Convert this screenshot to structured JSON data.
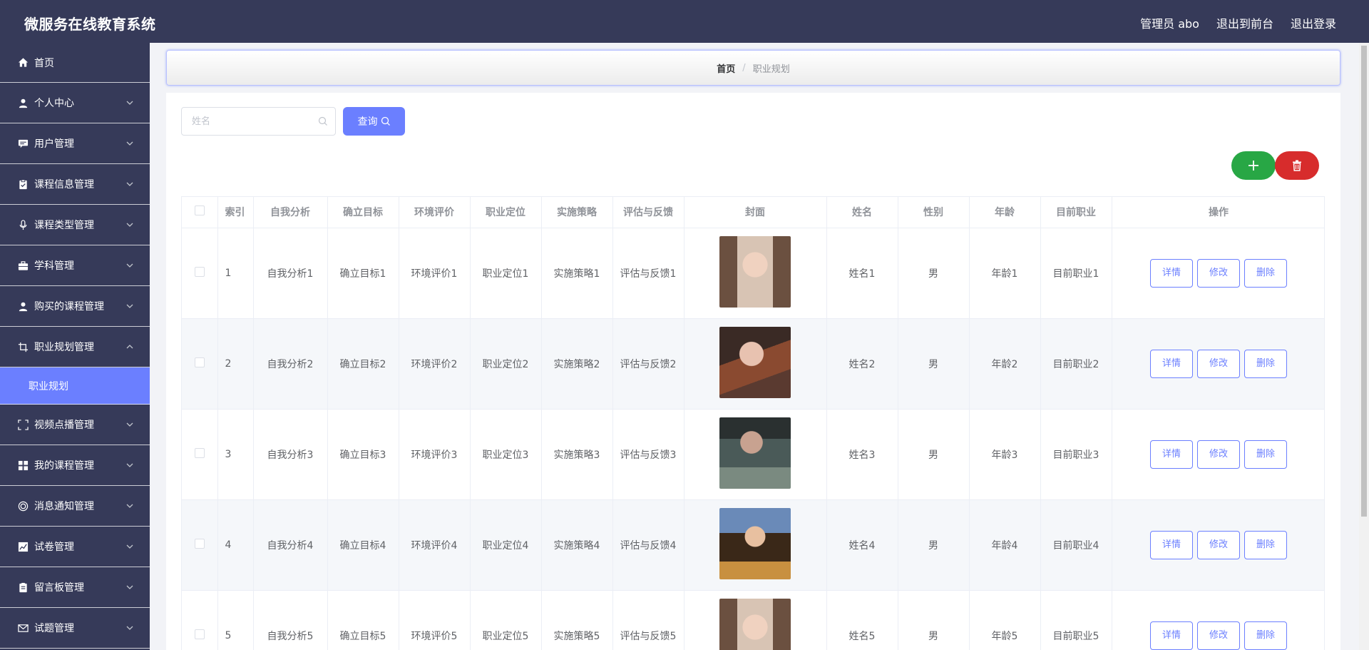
{
  "app": {
    "title": "微服务在线教育系统",
    "admin_label": "管理员 abo",
    "to_frontend": "退出到前台",
    "logout": "退出登录"
  },
  "sidebar": {
    "home": "首页",
    "items": [
      {
        "label": "个人中心",
        "icon": "user-icon"
      },
      {
        "label": "用户管理",
        "icon": "chat-icon"
      },
      {
        "label": "课程信息管理",
        "icon": "clipboard-icon"
      },
      {
        "label": "课程类型管理",
        "icon": "microphone-icon"
      },
      {
        "label": "学科管理",
        "icon": "briefcase-icon"
      },
      {
        "label": "购买的课程管理",
        "icon": "user-icon"
      },
      {
        "label": "职业规划管理",
        "icon": "crop-icon"
      },
      {
        "label": "视频点播管理",
        "icon": "fullscreen-icon"
      },
      {
        "label": "我的课程管理",
        "icon": "grid-icon"
      },
      {
        "label": "消息通知管理",
        "icon": "target-icon"
      },
      {
        "label": "试卷管理",
        "icon": "chart-icon"
      },
      {
        "label": "留言板管理",
        "icon": "notebook-icon"
      },
      {
        "label": "试题管理",
        "icon": "mail-icon"
      }
    ],
    "active_sub": "职业规划"
  },
  "breadcrumb": {
    "home": "首页",
    "separator": "/",
    "current": "职业规划"
  },
  "search": {
    "placeholder": "姓名",
    "query_label": "查询"
  },
  "colors": {
    "topbar": "#363a59",
    "accent": "#6b7fff",
    "add": "#28a745",
    "delete": "#d72c2c"
  },
  "table": {
    "headers": [
      "索引",
      "自我分析",
      "确立目标",
      "环境评价",
      "职业定位",
      "实施策略",
      "评估与反馈",
      "封面",
      "姓名",
      "性别",
      "年龄",
      "目前职业",
      "操作"
    ],
    "actions": {
      "detail": "详情",
      "edit": "修改",
      "delete": "删除"
    },
    "rows": [
      {
        "index": "1",
        "self_analysis": "自我分析1",
        "goal": "确立目标1",
        "env": "环境评价1",
        "position": "职业定位1",
        "strategy": "实施策略1",
        "feedback": "评估与反馈1",
        "name": "姓名1",
        "gender": "男",
        "age": "年龄1",
        "job": "目前职业1"
      },
      {
        "index": "2",
        "self_analysis": "自我分析2",
        "goal": "确立目标2",
        "env": "环境评价2",
        "position": "职业定位2",
        "strategy": "实施策略2",
        "feedback": "评估与反馈2",
        "name": "姓名2",
        "gender": "男",
        "age": "年龄2",
        "job": "目前职业2"
      },
      {
        "index": "3",
        "self_analysis": "自我分析3",
        "goal": "确立目标3",
        "env": "环境评价3",
        "position": "职业定位3",
        "strategy": "实施策略3",
        "feedback": "评估与反馈3",
        "name": "姓名3",
        "gender": "男",
        "age": "年龄3",
        "job": "目前职业3"
      },
      {
        "index": "4",
        "self_analysis": "自我分析4",
        "goal": "确立目标4",
        "env": "环境评价4",
        "position": "职业定位4",
        "strategy": "实施策略4",
        "feedback": "评估与反馈4",
        "name": "姓名4",
        "gender": "男",
        "age": "年龄4",
        "job": "目前职业4"
      },
      {
        "index": "5",
        "self_analysis": "自我分析5",
        "goal": "确立目标5",
        "env": "环境评价5",
        "position": "职业定位5",
        "strategy": "实施策略5",
        "feedback": "评估与反馈5",
        "name": "姓名5",
        "gender": "男",
        "age": "年龄5",
        "job": "目前职业5"
      }
    ]
  }
}
